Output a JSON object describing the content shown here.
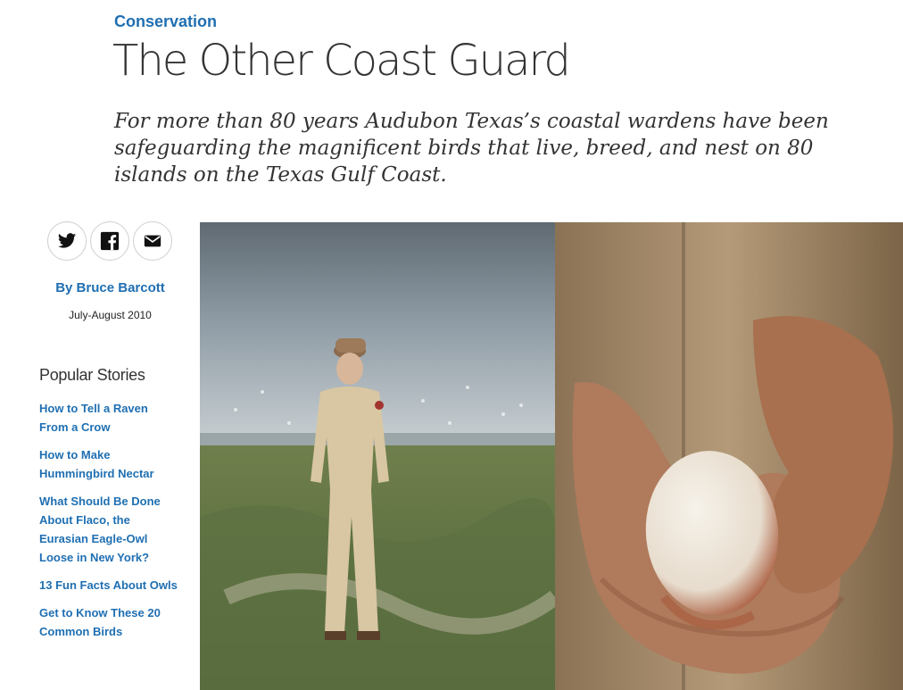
{
  "article": {
    "category": "Conservation",
    "title": "The Other Coast Guard",
    "dek": "For more than 80 years Audubon Texas’s coastal wardens have been safeguarding the magnificent birds that live, breed, and nest on 80 islands on the Texas Gulf Coast.",
    "byline": "By Bruce Barcott",
    "date": "July-August 2010"
  },
  "share": [
    {
      "icon": "twitter-icon"
    },
    {
      "icon": "facebook-icon"
    },
    {
      "icon": "email-icon"
    }
  ],
  "popular": {
    "heading": "Popular Stories",
    "items": [
      {
        "label": "How to Tell a Raven From a Crow"
      },
      {
        "label": "How to Make Hummingbird Nectar"
      },
      {
        "label": "What Should Be Done About Flaco, the Eurasian Eagle-Owl Loose in New York?"
      },
      {
        "label": "13 Fun Facts About Owls"
      },
      {
        "label": "Get to Know These 20 Common Birds"
      }
    ]
  },
  "colors": {
    "link": "#1f6fb2",
    "text": "#333333"
  }
}
